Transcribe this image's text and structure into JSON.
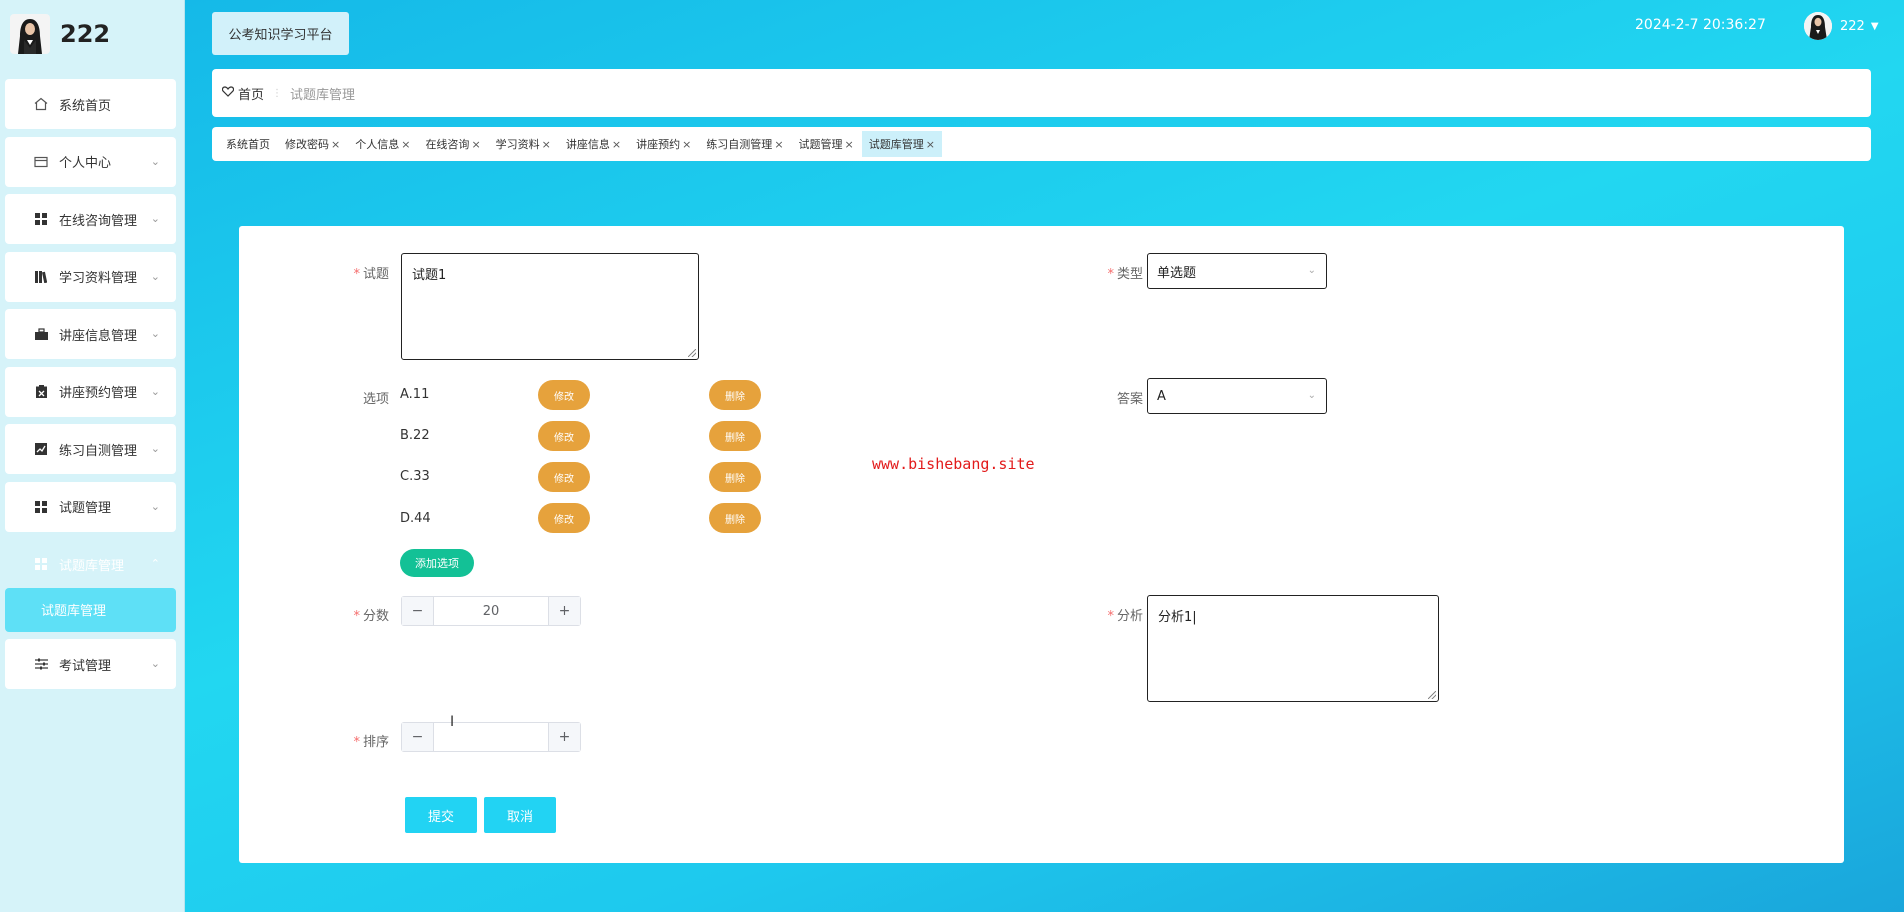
{
  "brand": {
    "name": "222"
  },
  "sidebar": {
    "items": [
      {
        "label": "系统首页",
        "icon": "home-icon",
        "chevron": ""
      },
      {
        "label": "个人中心",
        "icon": "id-card-icon",
        "chevron": "⌄"
      },
      {
        "label": "在线咨询管理",
        "icon": "grid-icon",
        "chevron": "⌄"
      },
      {
        "label": "学习资料管理",
        "icon": "book-icon",
        "chevron": "⌄"
      },
      {
        "label": "讲座信息管理",
        "icon": "briefcase-icon",
        "chevron": "⌄"
      },
      {
        "label": "讲座预约管理",
        "icon": "clipboard-icon",
        "chevron": "⌄"
      },
      {
        "label": "练习自测管理",
        "icon": "chart-icon",
        "chevron": "⌄"
      },
      {
        "label": "试题管理",
        "icon": "grid-icon",
        "chevron": "⌄"
      },
      {
        "label": "试题库管理",
        "icon": "grid-icon",
        "chevron": "⌃"
      },
      {
        "label": "考试管理",
        "icon": "sliders-icon",
        "chevron": "⌄"
      }
    ],
    "submenu_label": "试题库管理"
  },
  "header": {
    "platform_label": "公考知识学习平台",
    "datetime": "2024-2-7 20:36:27",
    "username": "222"
  },
  "breadcrumb": {
    "home": "首页",
    "current": "试题库管理"
  },
  "tags": [
    {
      "label": "系统首页",
      "closable": false
    },
    {
      "label": "修改密码",
      "closable": true
    },
    {
      "label": "个人信息",
      "closable": true
    },
    {
      "label": "在线咨询",
      "closable": true
    },
    {
      "label": "学习资料",
      "closable": true
    },
    {
      "label": "讲座信息",
      "closable": true
    },
    {
      "label": "讲座预约",
      "closable": true
    },
    {
      "label": "练习自测管理",
      "closable": true
    },
    {
      "label": "试题管理",
      "closable": true
    },
    {
      "label": "试题库管理",
      "closable": true,
      "active": true
    }
  ],
  "form": {
    "question_label": "试题",
    "question_value": "试题1",
    "type_label": "类型",
    "type_value": "单选题",
    "options_label": "选项",
    "options": [
      "A.11",
      "B.22",
      "C.33",
      "D.44"
    ],
    "edit_label": "修改",
    "delete_label": "删除",
    "add_option_label": "添加选项",
    "answer_label": "答案",
    "answer_value": "A",
    "score_label": "分数",
    "score_value": "20",
    "analysis_label": "分析",
    "analysis_value": "分析1|",
    "order_label": "排序",
    "order_value": "",
    "submit_label": "提交",
    "cancel_label": "取消",
    "minus": "−",
    "plus": "+"
  },
  "watermark": "www.bishebang.site",
  "colors": {
    "accent": "#22d3f3",
    "warning": "#e6a23c",
    "success": "#13c196",
    "required": "#f56c6c"
  }
}
